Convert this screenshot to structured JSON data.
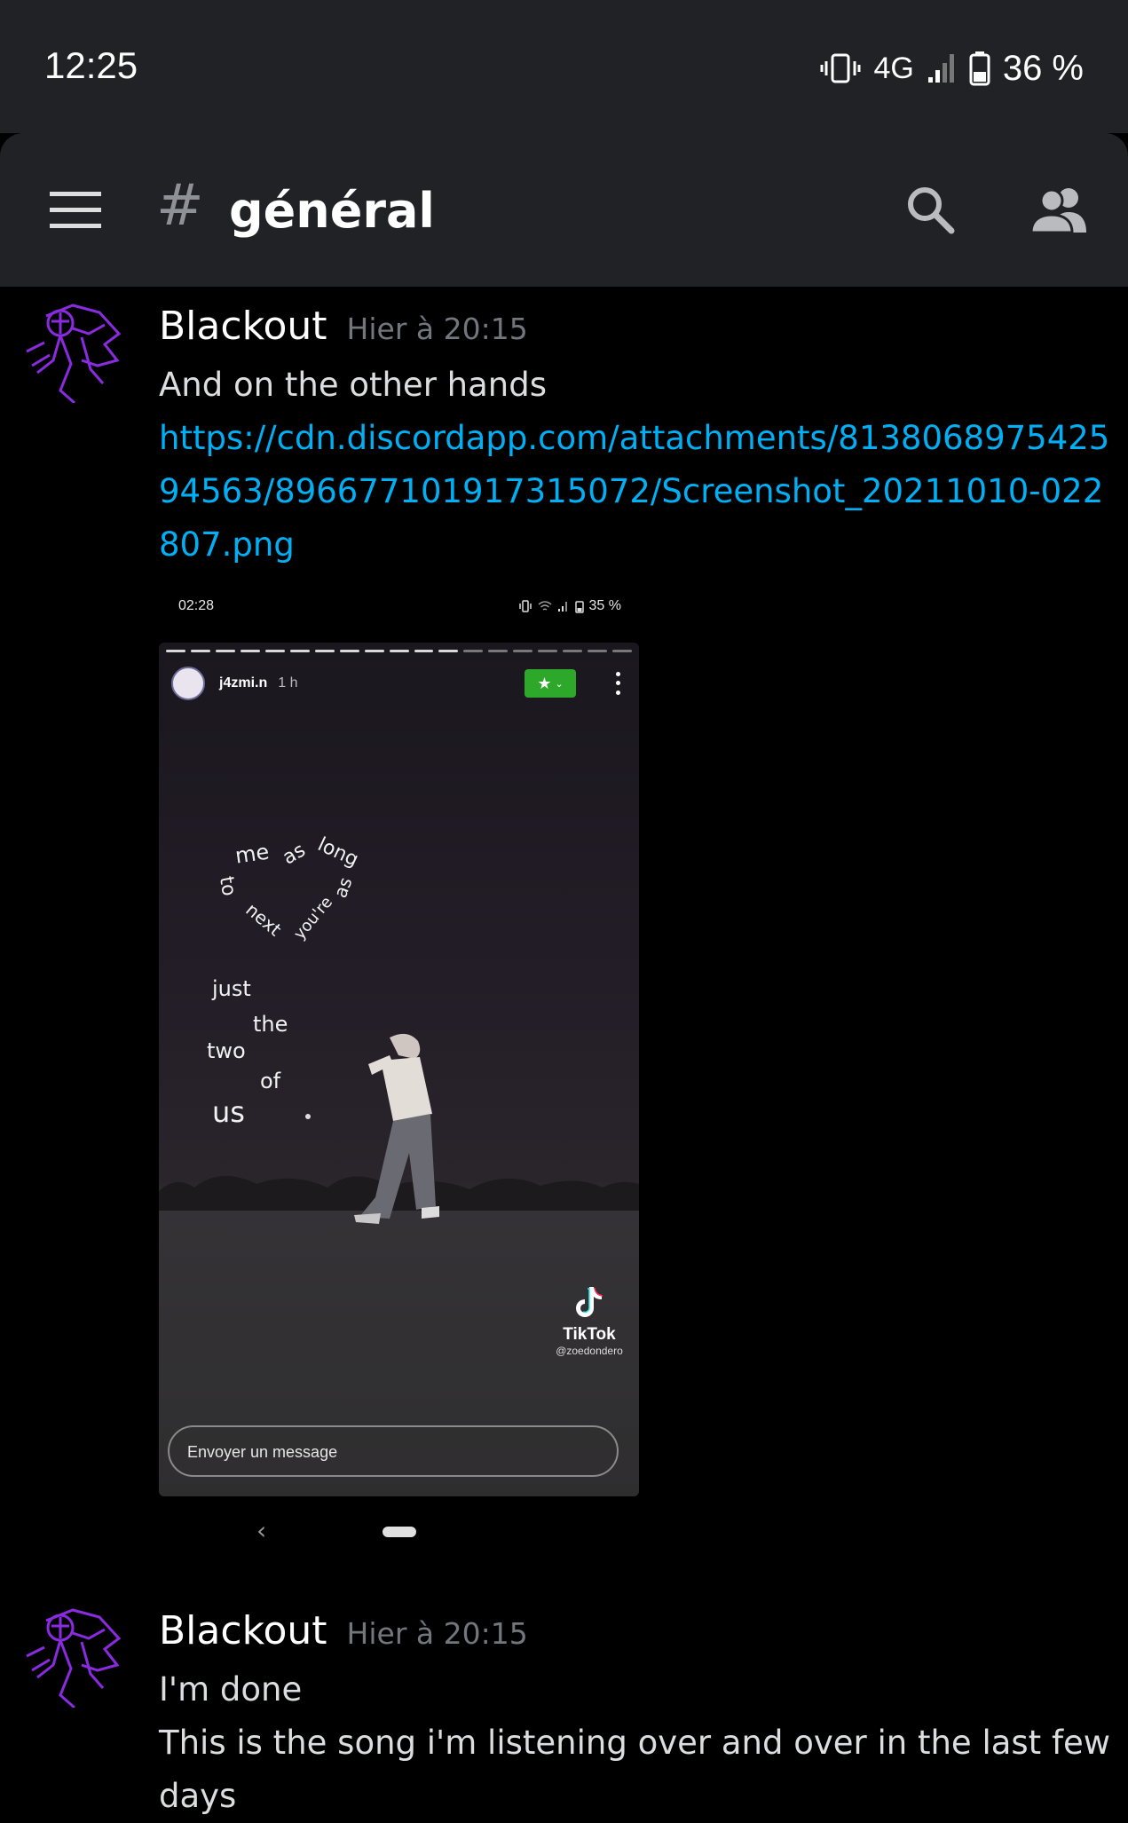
{
  "status_bar": {
    "time": "12:25",
    "network": "4G",
    "battery": "36 %",
    "icons": [
      "vibrate-icon",
      "signal-icon",
      "battery-icon"
    ]
  },
  "header": {
    "channel_prefix": "#",
    "channel_name": "général",
    "icons": [
      "hamburger-menu-icon",
      "search-icon",
      "members-icon"
    ]
  },
  "messages": [
    {
      "author": "Blackout",
      "timestamp": "Hier à 20:15",
      "lines": [
        "And on the other hands"
      ],
      "link": "https://cdn.discordapp.com/attachments/813806897542594563/896677101917315072/Screenshot_20211010-022807.png",
      "attachment": {
        "status_time": "02:28",
        "status_battery": "35 %",
        "story_user": "j4zmi.n",
        "story_time": "1 h",
        "curved_lyrics": [
          "me",
          "as",
          "long",
          "to",
          "next",
          "you're",
          "as"
        ],
        "lyrics": [
          "just",
          "the",
          "two",
          "of",
          "us"
        ],
        "watermark": "TikTok",
        "watermark_handle": "@zoedondero",
        "reply_placeholder": "Envoyer un message"
      }
    },
    {
      "author": "Blackout",
      "timestamp": "Hier à 20:15",
      "lines": [
        "I'm done",
        "This is the song i'm listening over and over in the last few days"
      ]
    }
  ],
  "colors": {
    "background": "#000000",
    "header_bg": "#202225",
    "link": "#00aff4",
    "timestamp": "#72767d",
    "text": "#dcddde",
    "avatar_accent": "#8a2be2"
  }
}
